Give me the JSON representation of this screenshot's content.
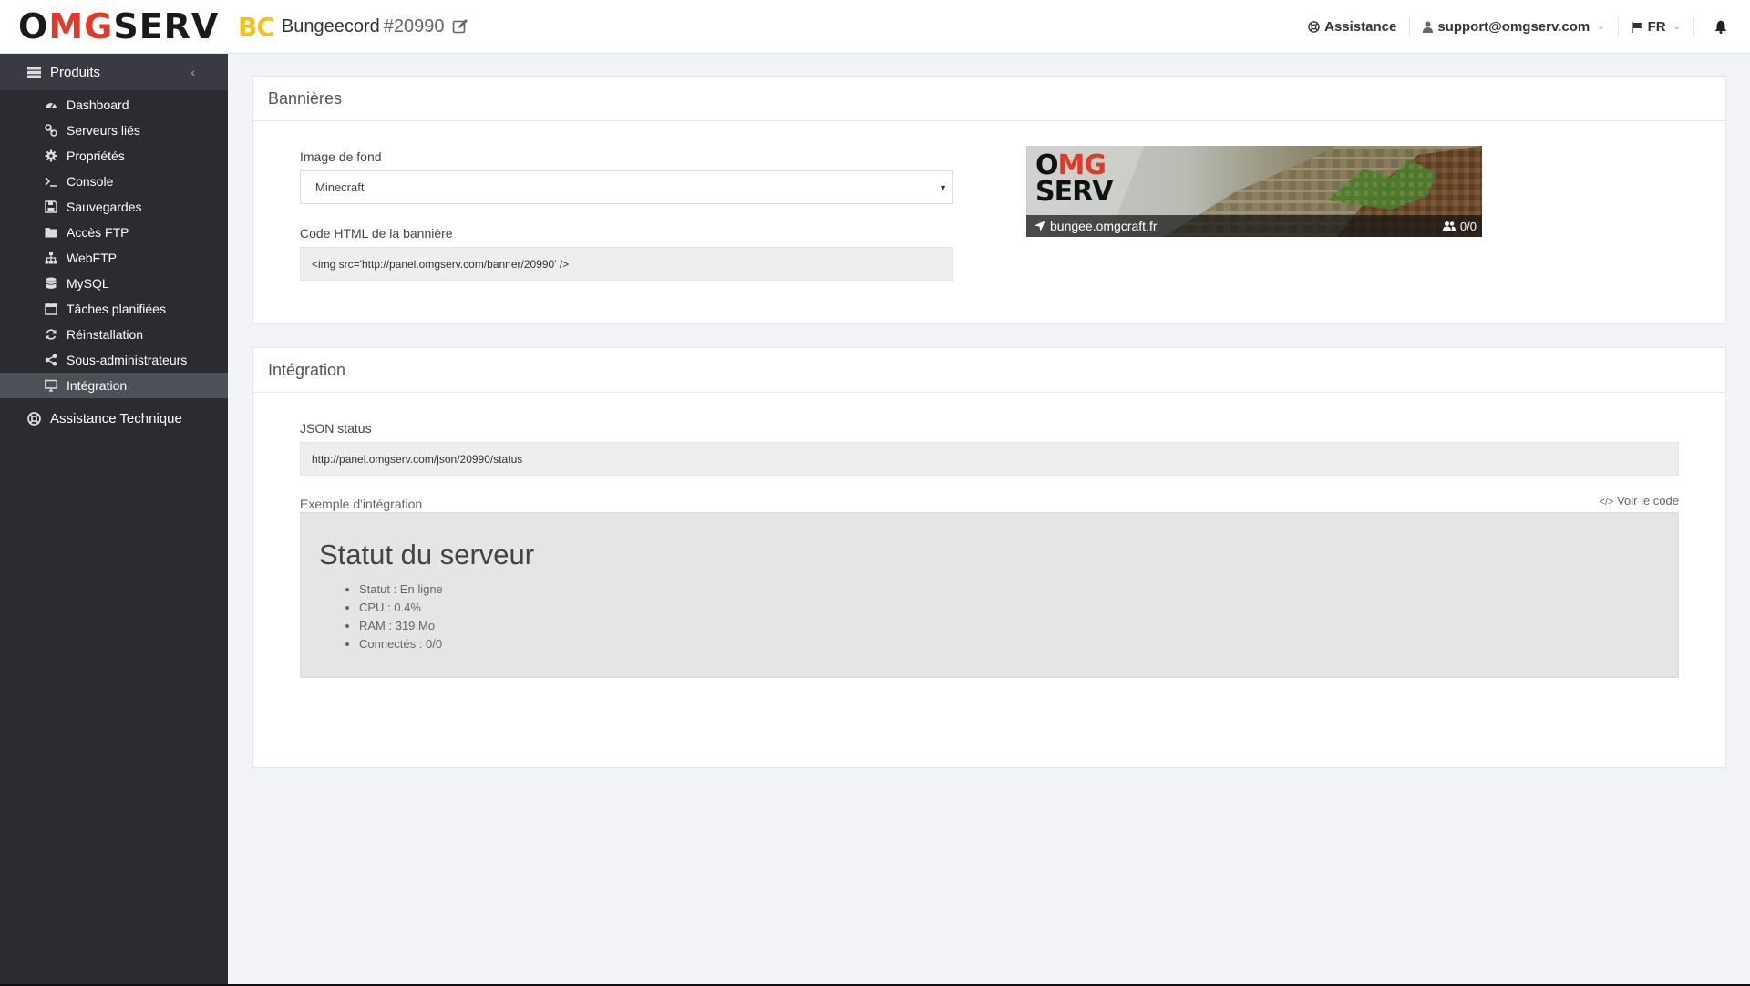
{
  "header": {
    "logo_o": "O",
    "logo_mg": "MG",
    "logo_rest": "SERV",
    "server_badge": "BC",
    "server_name": "Bungeecord",
    "server_id": "#20990",
    "assistance_label": "Assistance",
    "account_email": "support@omgserv.com",
    "language": "FR"
  },
  "sidebar": {
    "section_label": "Produits",
    "items": [
      {
        "label": "Dashboard",
        "icon": "dashboard-icon"
      },
      {
        "label": "Serveurs liés",
        "icon": "link-icon"
      },
      {
        "label": "Propriétés",
        "icon": "gear-icon"
      },
      {
        "label": "Console",
        "icon": "terminal-icon"
      },
      {
        "label": "Sauvegardes",
        "icon": "save-icon"
      },
      {
        "label": "Accès FTP",
        "icon": "folder-icon"
      },
      {
        "label": "WebFTP",
        "icon": "sitemap-icon"
      },
      {
        "label": "MySQL",
        "icon": "database-icon"
      },
      {
        "label": "Tâches planifiées",
        "icon": "calendar-icon"
      },
      {
        "label": "Réinstallation",
        "icon": "refresh-icon"
      },
      {
        "label": "Sous-administrateurs",
        "icon": "share-icon"
      },
      {
        "label": "Intégration",
        "icon": "monitor-icon",
        "active": true
      }
    ],
    "support_label": "Assistance Technique"
  },
  "banners": {
    "title": "Bannières",
    "background_label": "Image de fond",
    "background_value": "Minecraft",
    "html_code_label": "Code HTML de la bannière",
    "html_code_value": "<img src='http://panel.omgserv.com/banner/20990' />",
    "preview": {
      "logo_o": "O",
      "logo_mg": "MG",
      "logo_serv": "SERV",
      "address": "bungee.omgcraft.fr",
      "players": "0/0"
    }
  },
  "integration": {
    "title": "Intégration",
    "json_label": "JSON status",
    "json_url": "http://panel.omgserv.com/json/20990/status",
    "example_label": "Exemple d'intégration",
    "view_code_label": "Voir le code",
    "example_title": "Statut du serveur",
    "example_items": [
      "Statut : En ligne",
      "CPU : 0.4%",
      "RAM : 319 Mo",
      "Connectés : 0/0"
    ]
  },
  "colors": {
    "brand_red": "#e03b2a",
    "badge_yellow": "#f2c31a",
    "sidebar_bg": "#2b2c32",
    "sidebar_active": "#4e5058"
  }
}
